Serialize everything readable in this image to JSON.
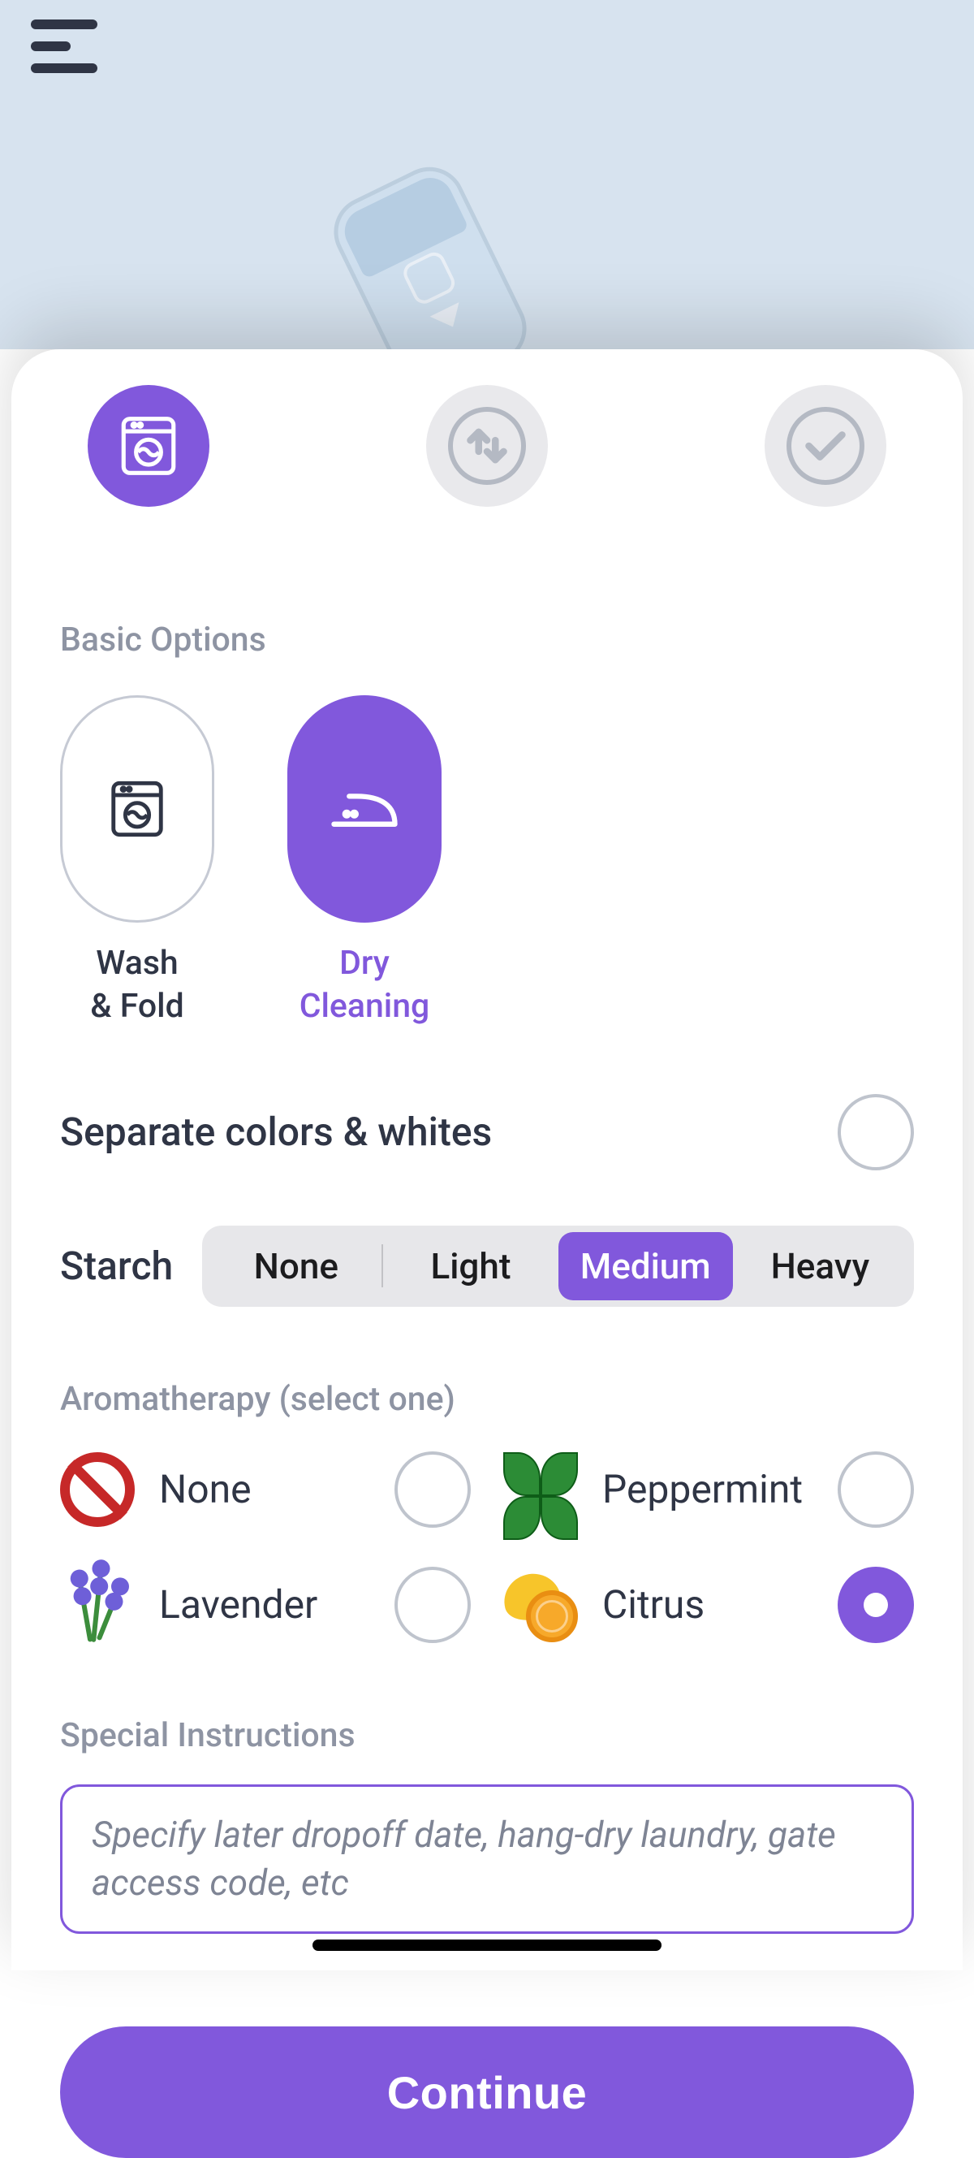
{
  "colors": {
    "accent": "#8158DC",
    "heroBackground": "#D7E3EF",
    "disabledStepBg": "#E9E9EC",
    "disabledStepStroke": "#B4B9C3",
    "segTrack": "#E7E7EA",
    "muted": "#8E94A3",
    "text": "#2F3545"
  },
  "steps": [
    {
      "icon": "washer-icon",
      "state": "active"
    },
    {
      "icon": "transfer-icon",
      "state": "inactive"
    },
    {
      "icon": "check-icon",
      "state": "inactive"
    }
  ],
  "sections": {
    "basic_label": "Basic Options",
    "aroma_label": "Aromatherapy (select one)",
    "special_label": "Special Instructions"
  },
  "basic_options": [
    {
      "id": "wash-fold",
      "label": "Wash\n& Fold",
      "icon": "washer-icon",
      "selected": false
    },
    {
      "id": "dry-cleaning",
      "label": "Dry\nCleaning",
      "icon": "iron-icon",
      "selected": true
    }
  ],
  "separate": {
    "label": "Separate colors & whites",
    "checked": false
  },
  "starch": {
    "label": "Starch",
    "options": [
      "None",
      "Light",
      "Medium",
      "Heavy"
    ],
    "selected": "Medium"
  },
  "aroma": [
    {
      "id": "none",
      "label": "None",
      "icon": "prohibit-icon",
      "selected": false
    },
    {
      "id": "peppermint",
      "label": "Peppermint",
      "icon": "mint-icon",
      "selected": false
    },
    {
      "id": "lavender",
      "label": "Lavender",
      "icon": "lavender-icon",
      "selected": false
    },
    {
      "id": "citrus",
      "label": "Citrus",
      "icon": "citrus-icon",
      "selected": true
    }
  ],
  "special": {
    "placeholder": "Specify later dropoff date, hang-dry laundry, gate access code, etc",
    "value": ""
  },
  "cta": {
    "label": "Continue"
  }
}
